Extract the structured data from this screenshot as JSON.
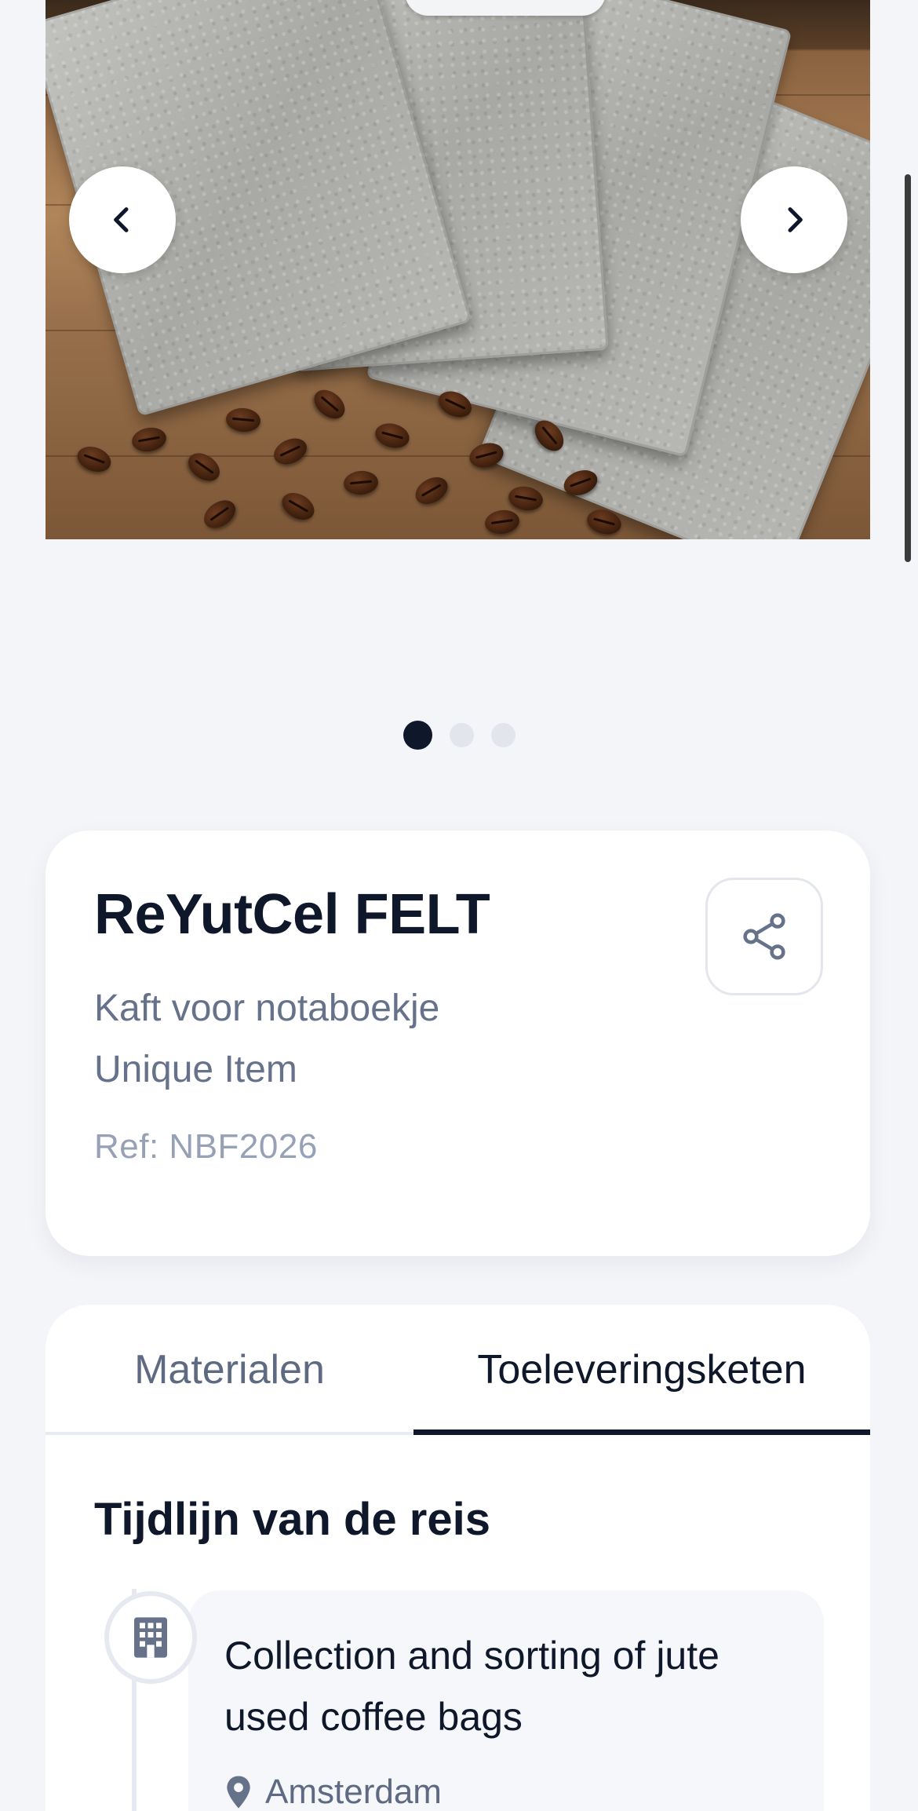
{
  "carousel": {
    "prev_icon": "chevron-left-icon",
    "next_icon": "chevron-right-icon",
    "slide_count": 3,
    "active_index": 0
  },
  "product": {
    "title": "ReYutCel FELT",
    "subtitle_line1": "Kaft voor notaboekje",
    "subtitle_line2": "Unique Item",
    "ref": "Ref: NBF2026",
    "share_icon": "share-icon"
  },
  "tabs": [
    {
      "label": "Materialen",
      "active": false
    },
    {
      "label": "Toeleveringsketen",
      "active": true
    }
  ],
  "timeline": {
    "title": "Tijdlijn van de reis",
    "steps": [
      {
        "icon": "building-icon",
        "title": "Collection and sorting of jute used coffee bags",
        "location": "Amsterdam",
        "location_icon": "location-pin-icon"
      }
    ]
  },
  "colors": {
    "background": "#f4f5f9",
    "text_primary": "#0f172a",
    "text_secondary": "#66728a",
    "text_muted": "#97a1b5",
    "active_dot": "#0f172a",
    "inactive_dot": "#e2e5ec"
  }
}
